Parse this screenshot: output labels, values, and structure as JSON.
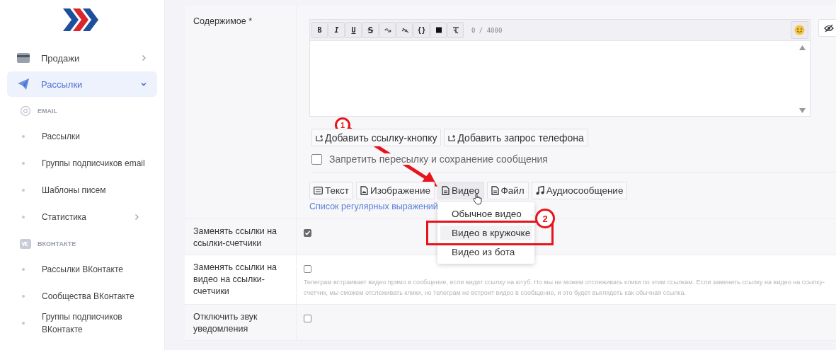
{
  "sidebar": {
    "menu": [
      {
        "label": "Продажи",
        "selected": false,
        "expanded": false
      },
      {
        "label": "Рассылки",
        "selected": true,
        "expanded": true
      }
    ],
    "sections": [
      {
        "title": "EMAIL",
        "items": [
          {
            "label": "Рассылки",
            "submenu": false
          },
          {
            "label": "Группы подписчиков email",
            "submenu": false
          },
          {
            "label": "Шаблоны писем",
            "submenu": false
          },
          {
            "label": "Статистика",
            "submenu": true
          }
        ]
      },
      {
        "title": "ВКОНТАКТЕ",
        "items": [
          {
            "label": "Рассылки ВКонтакте",
            "submenu": false
          },
          {
            "label": "Сообщества ВКонтакте",
            "submenu": false
          },
          {
            "label": "Группы подписчиков ВКонтакте",
            "submenu": false
          }
        ]
      }
    ]
  },
  "form": {
    "content": {
      "label": "Содержимое *",
      "toolbar": [
        {
          "kind": "bold",
          "label": "B"
        },
        {
          "kind": "italic",
          "label": "I"
        },
        {
          "kind": "underline",
          "label": "U"
        },
        {
          "kind": "strike",
          "label": "S"
        },
        {
          "kind": "link"
        },
        {
          "kind": "unlink"
        },
        {
          "kind": "code",
          "label": "{}"
        },
        {
          "kind": "block"
        },
        {
          "kind": "clear"
        }
      ],
      "counter": "0 / 4000",
      "extra_buttons": [
        "Добавить ссылку-кнопку",
        "Добавить запрос телефона"
      ],
      "forbid_forward": {
        "label": "Запретить пересылку и сохранение сообщения",
        "checked": false
      },
      "types": [
        {
          "label": "Текст",
          "selected": false
        },
        {
          "label": "Изображение",
          "selected": false
        },
        {
          "label": "Видео",
          "selected": true
        },
        {
          "label": "Файл",
          "selected": false
        },
        {
          "label": "Аудиосообщение",
          "selected": false
        }
      ],
      "dropdown": [
        {
          "label": "Обычное видео",
          "selected": false
        },
        {
          "label": "Видео в кружочке",
          "selected": true
        },
        {
          "label": "Видео из бота",
          "selected": false
        }
      ],
      "regex_link": "Список регулярных выражений"
    },
    "options": [
      {
        "label": "Заменять ссылки на ссылки-счетчики",
        "checked": true
      },
      {
        "label": "Заменять ссылки на видео на ссылки-счетчики",
        "checked": false,
        "hint": "Телеграм встраивает видео прямо в сообщение, если видит ссылку на ютуб. Но мы не можем отслеживать клики по этим ссылкам. Если заменить ссылку на видео на ссылку-счетчик, мы сможем отслеживать клики, но телеграм не встроит видео в сообщение, и это будет выглядеть как обычная ссылка."
      },
      {
        "label": "Отключить звук уведомления",
        "checked": false
      }
    ]
  },
  "annotations": [
    {
      "number": "1"
    },
    {
      "number": "2"
    }
  ]
}
